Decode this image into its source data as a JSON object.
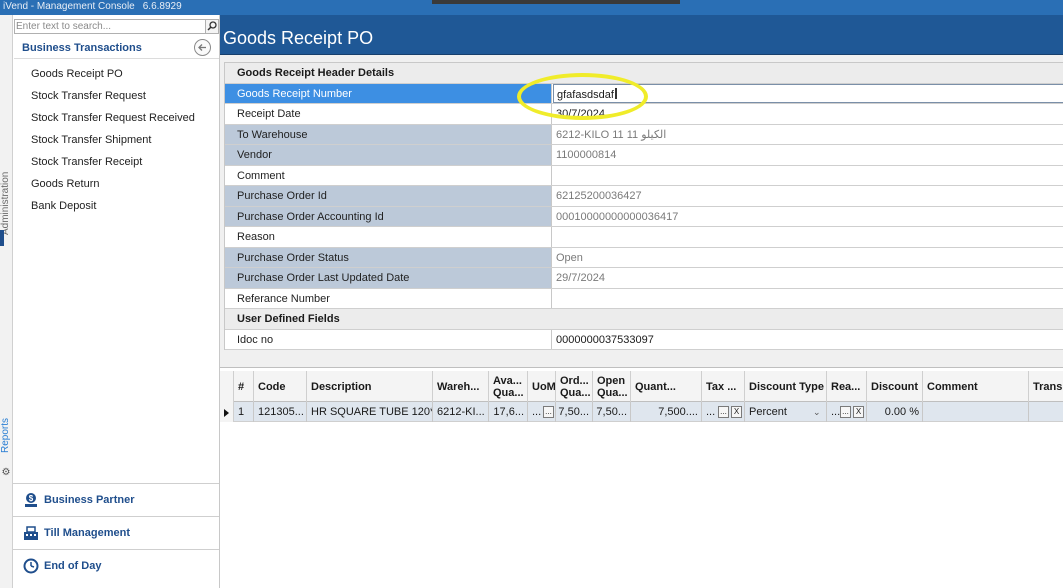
{
  "app": {
    "title": "iVend - Management Console",
    "version": "6.6.8929"
  },
  "strip": {
    "vertical_label": "Administration",
    "blue_label": "Reports"
  },
  "sidebar": {
    "search_placeholder": "Enter text to search...",
    "section_title": "Business Transactions",
    "items": [
      {
        "label": "Goods Receipt PO"
      },
      {
        "label": "Stock Transfer Request"
      },
      {
        "label": "Stock Transfer Request Received"
      },
      {
        "label": "Stock Transfer Shipment"
      },
      {
        "label": "Stock Transfer Receipt"
      },
      {
        "label": "Goods Return"
      },
      {
        "label": "Bank Deposit"
      }
    ],
    "bottom": [
      {
        "label": "Business Partner",
        "icon": "business-partner-icon"
      },
      {
        "label": "Till Management",
        "icon": "till-management-icon"
      },
      {
        "label": "End of Day",
        "icon": "clock-icon"
      }
    ]
  },
  "main": {
    "title": "Goods Receipt PO"
  },
  "form": {
    "header_section": "Goods Receipt Header Details",
    "fields": {
      "goods_receipt_number": {
        "label": "Goods Receipt Number",
        "value": "gfafasdsdaf"
      },
      "receipt_date": {
        "label": "Receipt Date",
        "value": "30/7/2024"
      },
      "to_warehouse": {
        "label": "To Warehouse",
        "value": "6212-KILO 11 11 الكيلو"
      },
      "vendor": {
        "label": "Vendor",
        "value": "1100000814"
      },
      "comment": {
        "label": "Comment",
        "value": ""
      },
      "purchase_order_id": {
        "label": "Purchase Order Id",
        "value": "62125200036427"
      },
      "purchase_order_accounting_id": {
        "label": "Purchase Order Accounting Id",
        "value": "00010000000000036417"
      },
      "reason": {
        "label": "Reason",
        "value": ""
      },
      "purchase_order_status": {
        "label": "Purchase Order Status",
        "value": "Open"
      },
      "purchase_order_last_updated_date": {
        "label": "Purchase Order Last Updated Date",
        "value": "29/7/2024"
      },
      "referance_number": {
        "label": "Referance Number",
        "value": ""
      }
    },
    "udf_section": "User Defined Fields",
    "udf": {
      "idoc_no": {
        "label": "Idoc no",
        "value": "0000000037533097"
      }
    },
    "highlight_color": "#f0ec2a",
    "selected_label_color": "#3d8fe3"
  },
  "grid": {
    "columns": [
      "#",
      "Code",
      "Description",
      "Wareh...",
      "Ava... Qua...",
      "UoM",
      "Ord... Qua...",
      "Open Qua...",
      "Quant...",
      "Tax ...",
      "Discount Type",
      "Rea...",
      "Discount",
      "Comment",
      "Trans"
    ],
    "rows": [
      {
        "num": "1",
        "code": "121305...",
        "description": "HR SQUARE TUBE 120*...",
        "warehouse": "6212-KI...",
        "available_qty": "17,6...",
        "uom": "...",
        "ordered_qty": "7,50...",
        "open_qty": "7,50...",
        "quantity": "7,500....",
        "tax": "...",
        "discount_type": "Percent",
        "reason": "...",
        "discount": "0.00 %",
        "comment": "",
        "trans": ""
      }
    ],
    "ellipsis_btn": "...",
    "clear_btn": "X"
  }
}
